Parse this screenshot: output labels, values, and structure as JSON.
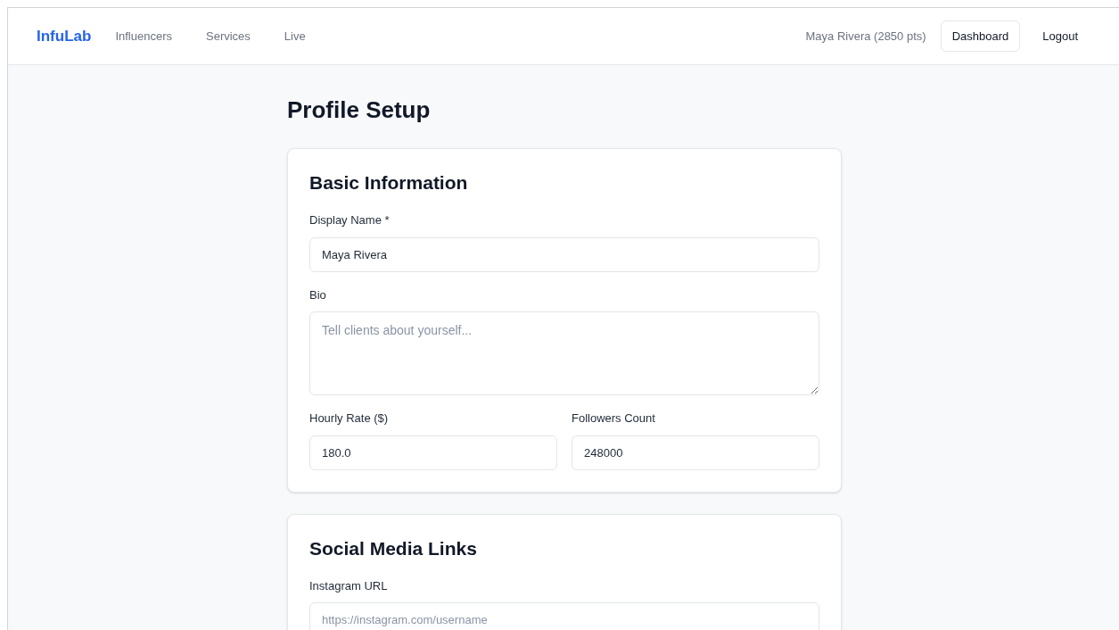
{
  "nav": {
    "brand": "InfuLab",
    "links": [
      {
        "label": "Influencers"
      },
      {
        "label": "Services"
      },
      {
        "label": "Live"
      }
    ],
    "user": "Maya Rivera (2850 pts)",
    "buttons": [
      {
        "label": "Dashboard",
        "kind": "outlined"
      },
      {
        "label": "Logout",
        "kind": "plain"
      }
    ]
  },
  "page_title": "Profile Setup",
  "sections": [
    {
      "title": "Basic Information",
      "rows": [
        [
          {
            "label": "Display Name *",
            "kind": "input",
            "value": "Maya Rivera"
          }
        ],
        [
          {
            "label": "Bio",
            "kind": "textarea",
            "placeholder": "Tell clients about yourself..."
          }
        ],
        [
          {
            "label": "Hourly Rate ($)",
            "kind": "input",
            "value": "180.0"
          },
          {
            "label": "Followers Count",
            "kind": "input",
            "value": "248000"
          }
        ]
      ]
    },
    {
      "title": "Social Media Links",
      "rows": [
        [
          {
            "label": "Instagram URL",
            "kind": "input",
            "placeholder": "https://instagram.com/username"
          }
        ]
      ]
    }
  ]
}
